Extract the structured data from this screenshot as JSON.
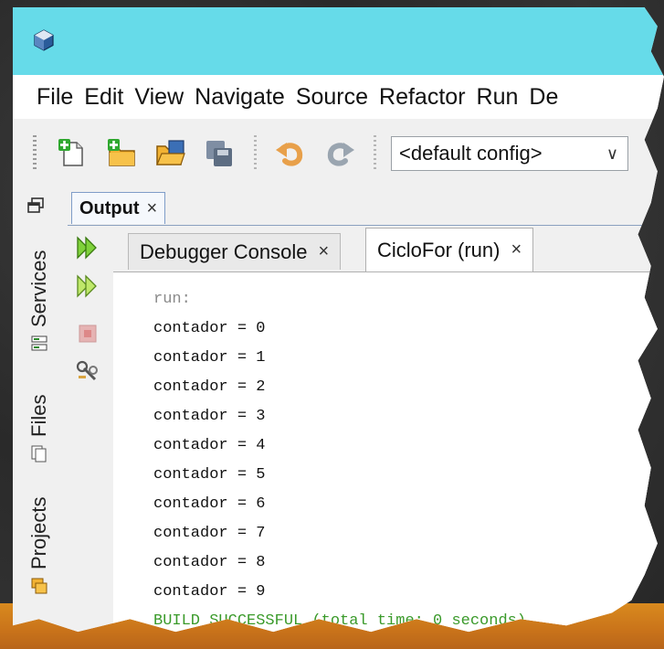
{
  "window": {
    "menu": [
      "File",
      "Edit",
      "View",
      "Navigate",
      "Source",
      "Refactor",
      "Run",
      "De"
    ]
  },
  "toolbar": {
    "config_value": "<default config>"
  },
  "side_tabs": [
    "Services",
    "Files",
    "Projects"
  ],
  "output": {
    "tab_label": "Output",
    "close_glyph": "×",
    "console_tabs": [
      {
        "label": "Debugger Console",
        "active": false
      },
      {
        "label": "CicloFor (run)",
        "active": true
      }
    ],
    "lines": [
      "run:",
      "contador = 0",
      "contador = 1",
      "contador = 2",
      "contador = 3",
      "contador = 4",
      "contador = 5",
      "contador = 6",
      "contador = 7",
      "contador = 8",
      "contador = 9",
      "BUILD SUCCESSFUL (total time: 0 seconds)"
    ]
  },
  "colors": {
    "titlebar": "#66dbe9",
    "build_success": "#3a9a2a"
  }
}
